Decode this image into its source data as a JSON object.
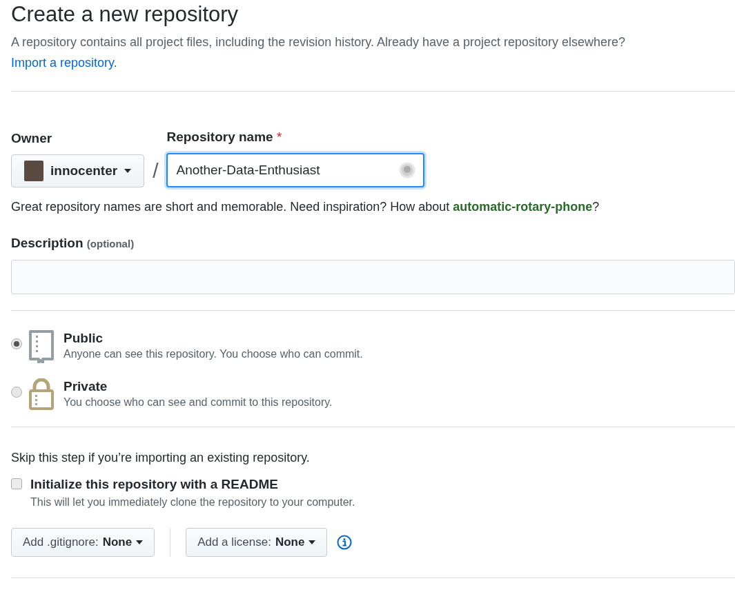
{
  "heading": "Create a new repository",
  "intro": "A repository contains all project files, including the revision history. Already have a project repository elsewhere?",
  "import_link": "Import a repository.",
  "owner": {
    "label": "Owner",
    "value": "innocenter"
  },
  "separator": "/",
  "repo_name": {
    "label": "Repository name",
    "required_mark": "*",
    "value": "Another-Data-Enthusiast"
  },
  "name_hint": "Great repository names are short and memorable. Need inspiration? How about **automatic-rotary-phone**?",
  "description": {
    "label": "Description",
    "note": "(optional)"
  },
  "visibility": [
    {
      "kind": "public",
      "title": "Public",
      "description": "Anyone can see this repository. You choose who can commit.",
      "selected": true
    },
    {
      "kind": "private",
      "title": "Private",
      "description": "You choose who can see and commit to this repository.",
      "selected": false
    }
  ],
  "skip_note": "Skip this step if you’re importing an existing repository.",
  "readme": {
    "label": "Initialize this repository with a README",
    "description": "This will let you immediately clone the repository to your computer.",
    "checked": false
  },
  "gitignore": {
    "label": "Add .gitignore:",
    "value": "None"
  },
  "license": {
    "label": "Add a license:",
    "value": "None"
  }
}
